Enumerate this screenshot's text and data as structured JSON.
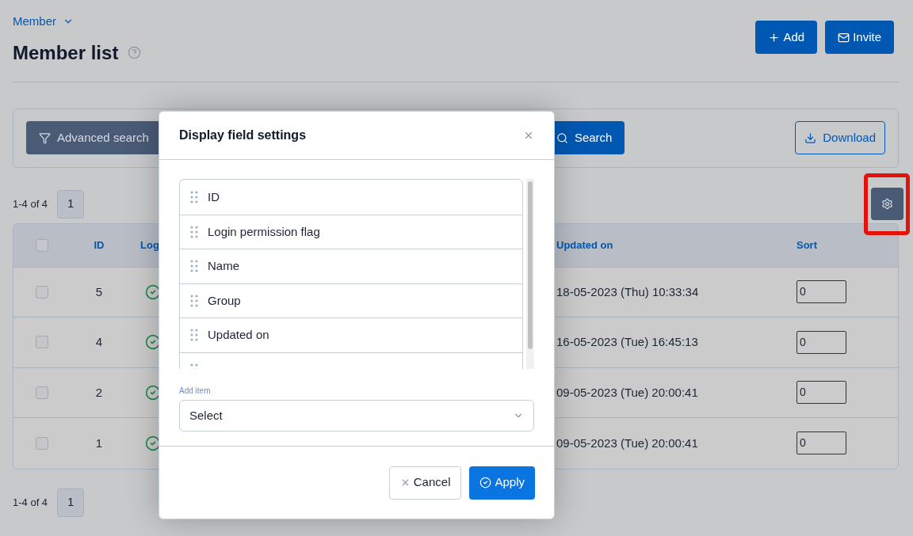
{
  "breadcrumb": {
    "label": "Member"
  },
  "title": "Member list",
  "header_buttons": [
    {
      "kind": "add",
      "label": "Add"
    },
    {
      "kind": "invite",
      "label": "Invite"
    }
  ],
  "search_panel": {
    "advanced_search": "Advanced search",
    "search": "Search",
    "download": "Download"
  },
  "pagination_top": {
    "range": "1-4 of 4",
    "pages": [
      {
        "label": "1",
        "selected": true
      }
    ]
  },
  "settings_highlighted": true,
  "table": {
    "select_all_checked": false,
    "columns": [
      "ID",
      "Log",
      "Updated on",
      "Sort"
    ],
    "rows": [
      {
        "checked": false,
        "id": "5",
        "login": true,
        "updated": "18-05-2023 (Thu) 10:33:34",
        "sort": "0"
      },
      {
        "checked": false,
        "id": "4",
        "login": true,
        "updated": "16-05-2023 (Tue) 16:45:13",
        "sort": "0"
      },
      {
        "checked": false,
        "id": "2",
        "login": true,
        "updated": "09-05-2023 (Tue) 20:00:41",
        "sort": "0"
      },
      {
        "checked": false,
        "id": "1",
        "login": true,
        "updated": "09-05-2023 (Tue) 20:00:41",
        "sort": "0"
      }
    ]
  },
  "pagination_bottom": {
    "range": "1-4 of 4",
    "pages": [
      {
        "label": "1",
        "selected": true
      }
    ]
  },
  "dialog": {
    "title": "Display field settings",
    "fields": [
      "ID",
      "Login permission flag",
      "Name",
      "Group",
      "Updated on"
    ],
    "add_item": {
      "label": "Add item",
      "placeholder": "Select"
    },
    "buttons": [
      {
        "kind": "cancel",
        "label": "Cancel"
      },
      {
        "kind": "apply",
        "label": "Apply"
      }
    ]
  }
}
